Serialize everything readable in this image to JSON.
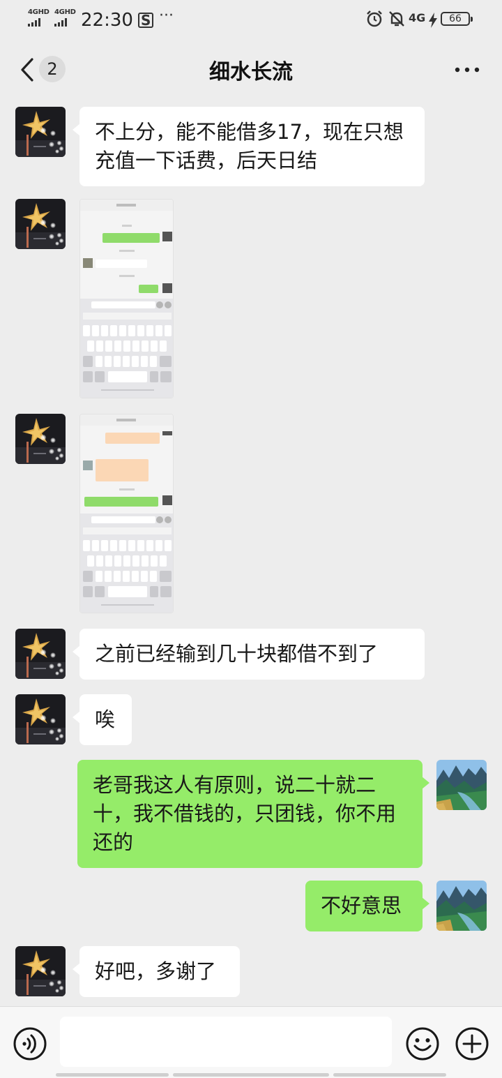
{
  "status_bar": {
    "network_1": "4GHD",
    "network_2": "4GHD",
    "time": "22:30",
    "notif_icon": "S",
    "more": "···",
    "cellular": "4G",
    "battery": "66"
  },
  "header": {
    "back_count": "2",
    "title": "细水长流",
    "more_label": "···"
  },
  "messages": [
    {
      "side": "in",
      "type": "text",
      "text": "不上分，能不能借多17，现在只想充值一下话费，后天日结"
    },
    {
      "side": "in",
      "type": "image",
      "icon": "chat-screenshot-thumbnail"
    },
    {
      "side": "in",
      "type": "image",
      "icon": "chat-screenshot-thumbnail"
    },
    {
      "side": "in",
      "type": "text",
      "text": "之前已经输到几十块都借不到了"
    },
    {
      "side": "in",
      "type": "text",
      "text": "唉"
    },
    {
      "side": "out",
      "type": "text",
      "text": "老哥我这人有原则，说二十就二十，我不借钱的，只团钱，你不用还的"
    },
    {
      "side": "out",
      "type": "text",
      "text": "不好意思"
    },
    {
      "side": "in",
      "type": "text",
      "text": "好吧，多谢了"
    }
  ],
  "input": {
    "placeholder": "",
    "value": ""
  },
  "colors": {
    "background": "#ededed",
    "bubble_in": "#ffffff",
    "bubble_out": "#95ec69"
  }
}
